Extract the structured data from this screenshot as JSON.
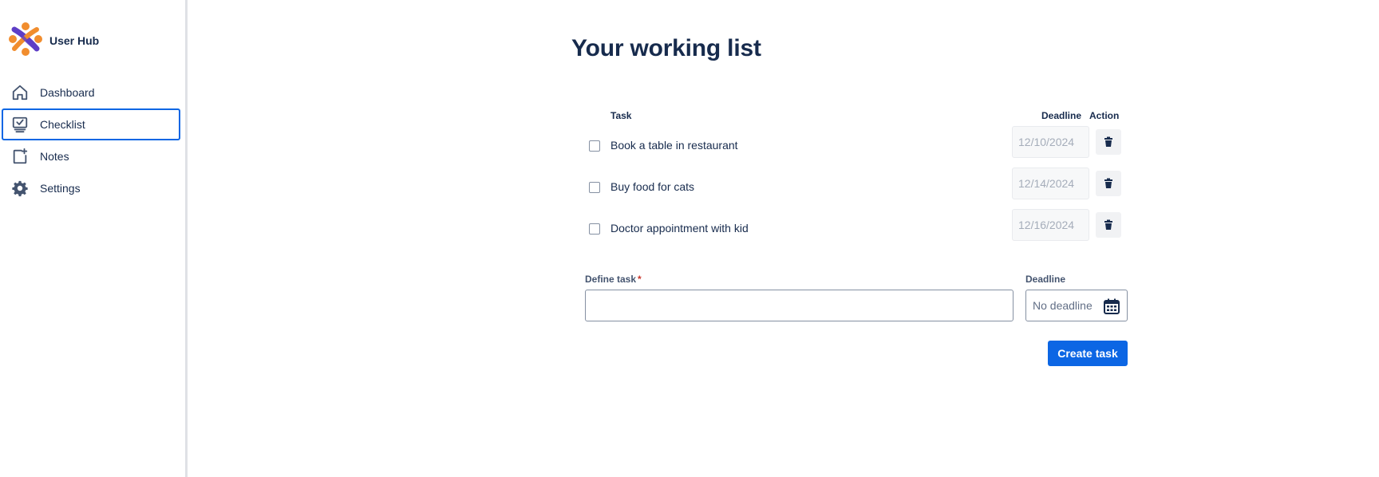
{
  "app": {
    "name": "User Hub"
  },
  "sidebar": {
    "items": [
      {
        "label": "Dashboard",
        "icon": "home-icon",
        "active": false
      },
      {
        "label": "Checklist",
        "icon": "checklist-icon",
        "active": true
      },
      {
        "label": "Notes",
        "icon": "notes-icon",
        "active": false
      },
      {
        "label": "Settings",
        "icon": "gear-icon",
        "active": false
      }
    ]
  },
  "main": {
    "title": "Your working list",
    "columns": {
      "task": "Task",
      "deadline": "Deadline",
      "action": "Action"
    },
    "tasks": [
      {
        "text": "Book a table in restaurant",
        "deadline": "12/10/2024",
        "done": false
      },
      {
        "text": "Buy food for cats",
        "deadline": "12/14/2024",
        "done": false
      },
      {
        "text": "Doctor appointment with kid",
        "deadline": "12/16/2024",
        "done": false
      }
    ],
    "form": {
      "task_label": "Define task",
      "required_marker": "*",
      "task_value": "",
      "deadline_label": "Deadline",
      "deadline_placeholder": "No deadline",
      "submit_label": "Create task"
    }
  },
  "colors": {
    "accent": "#0c66e4",
    "text": "#172b4d",
    "required": "#c9372c",
    "logo_orange": "#f18d2e",
    "logo_purple": "#5e3ec6"
  }
}
